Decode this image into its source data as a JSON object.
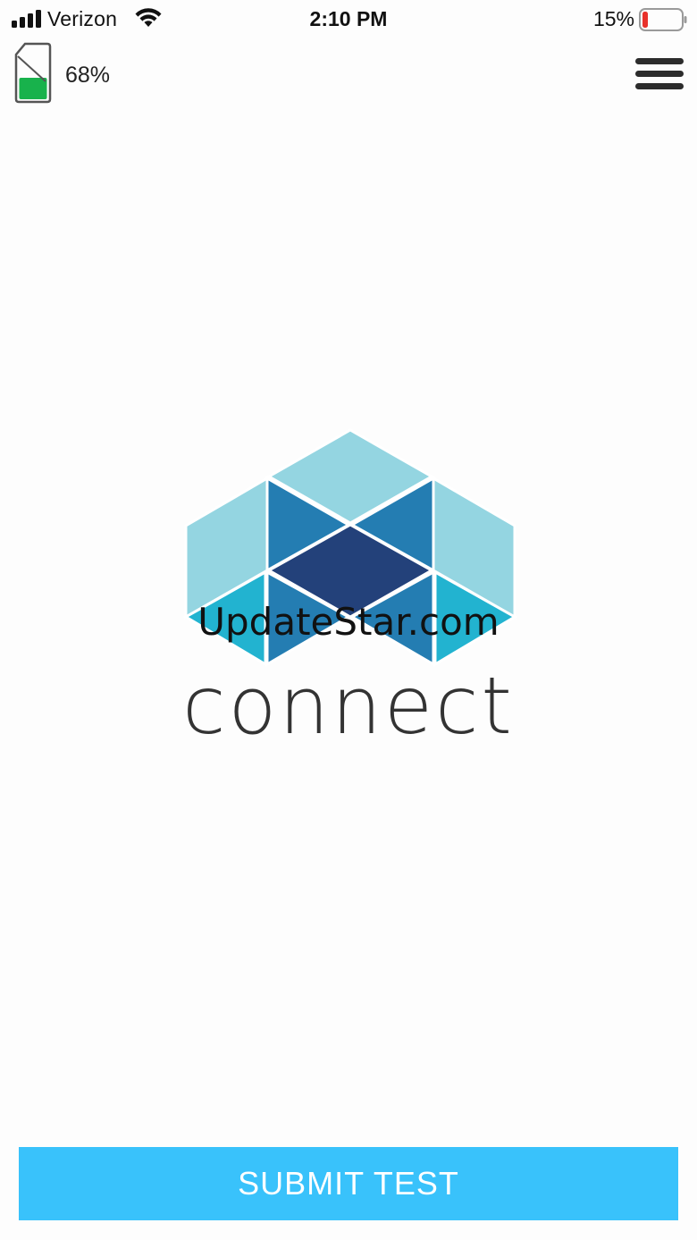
{
  "status_bar": {
    "carrier": "Verizon",
    "time": "2:10 PM",
    "battery_percent": "15%",
    "icons": [
      "signal-icon",
      "wifi-icon",
      "battery-icon"
    ]
  },
  "header": {
    "device_battery_percent": "68%",
    "device_battery_level": 0.68,
    "menu_icon": "hamburger-menu-icon"
  },
  "logo": {
    "wordmark": "connect",
    "watermark": "UpdateStar.com"
  },
  "actions": {
    "submit_label": "SUBMIT TEST"
  },
  "colors": {
    "accent": "#39c2fb",
    "logo_light": "#94d5e1",
    "logo_mid": "#247db2",
    "logo_dark": "#23417a",
    "logo_teal": "#22b3d0",
    "battery_green": "#18b24c",
    "status_battery_red": "#e8312b"
  }
}
